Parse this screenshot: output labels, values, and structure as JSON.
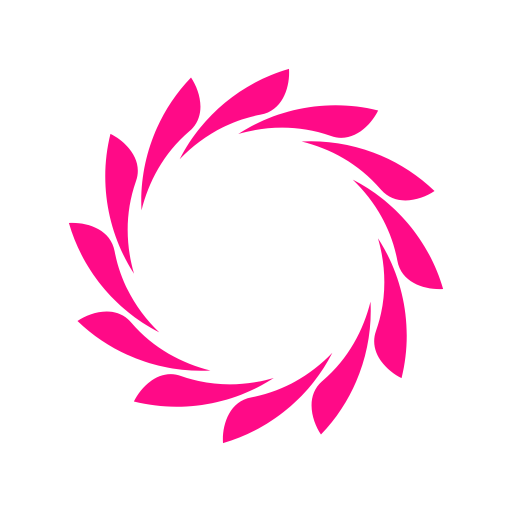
{
  "logo": {
    "icon": "pink-swirl-icon",
    "fill_color": "#ff0a87",
    "background_color": "#ffffff",
    "petal_count": 12
  }
}
